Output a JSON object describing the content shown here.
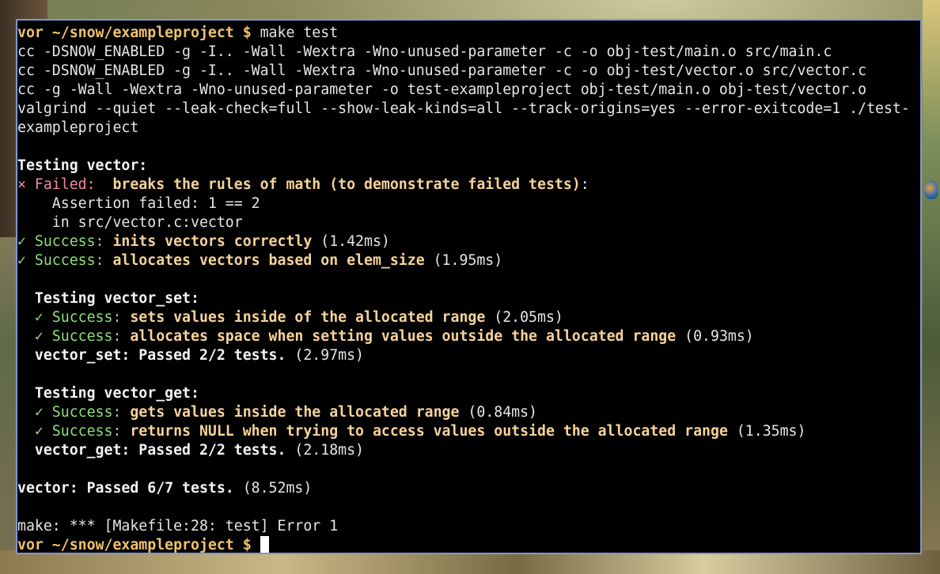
{
  "terminal": {
    "prompt_user": "vor",
    "prompt_path": " ~/snow/exampleproject $",
    "command": " make test",
    "build_lines": [
      "cc -DSNOW_ENABLED -g -I.. -Wall -Wextra -Wno-unused-parameter -c -o obj-test/main.o src/main.c",
      "cc -DSNOW_ENABLED -g -I.. -Wall -Wextra -Wno-unused-parameter -c -o obj-test/vector.o src/vector.c",
      "cc -g -Wall -Wextra -Wno-unused-parameter -o test-exampleproject obj-test/main.o obj-test/vector.o",
      "valgrind --quiet --leak-check=full --show-leak-kinds=all --track-origins=yes --error-exitcode=1 ./test-",
      "exampleproject"
    ],
    "suite_vector": {
      "heading": "Testing vector:",
      "failed_marker": "× Failed: ",
      "failed_name": " breaks the rules of math (to demonstrate failed tests)",
      "failed_colon": ":",
      "assertion": "    Assertion failed: 1 == 2",
      "location": "    in src/vector.c:vector",
      "successes": [
        {
          "marker": "✓ Success:",
          "name": " inits vectors correctly",
          "time": " (1.42ms)"
        },
        {
          "marker": "✓ Success:",
          "name": " allocates vectors based on elem_size",
          "time": " (1.95ms)"
        }
      ]
    },
    "suite_vector_set": {
      "heading": "  Testing vector_set:",
      "successes": [
        {
          "marker": "  ✓ Success:",
          "name": " sets values inside of the allocated range",
          "time": " (2.05ms)"
        },
        {
          "marker": "  ✓ Success:",
          "name": " allocates space when setting values outside the allocated range",
          "time": " (0.93ms)"
        }
      ],
      "summary": "  vector_set: Passed 2/2 tests.",
      "summary_time": " (2.97ms)"
    },
    "suite_vector_get": {
      "heading": "  Testing vector_get:",
      "successes": [
        {
          "marker": "  ✓ Success:",
          "name": " gets values inside the allocated range",
          "time": " (0.84ms)"
        },
        {
          "marker": "  ✓ Success:",
          "name": " returns NULL when trying to access values outside the allocated range",
          "time": " (1.35ms)"
        }
      ],
      "summary": "  vector_get: Passed 2/2 tests.",
      "summary_time": " (2.18ms)"
    },
    "overall_summary": "vector: Passed 6/7 tests.",
    "overall_time": " (8.52ms)",
    "make_error": "make: *** [Makefile:28: test] Error 1"
  },
  "colors": {
    "terminal_bg": "#000000",
    "window_border": "#7f97d6",
    "prompt": "#f0c36c",
    "failed": "#f08aa6",
    "success": "#8fe07a",
    "test_name": "#f6d39a"
  }
}
